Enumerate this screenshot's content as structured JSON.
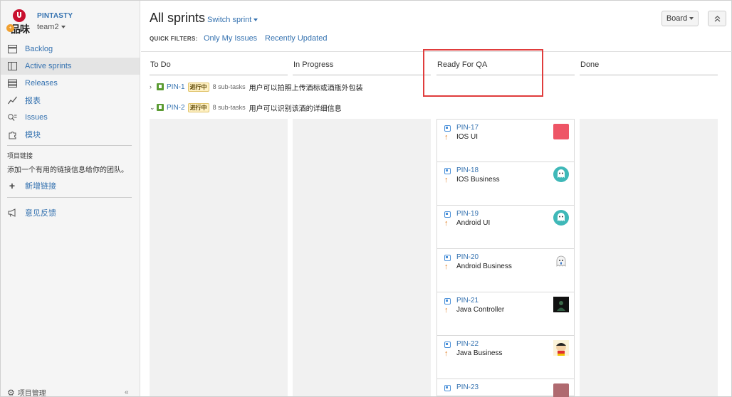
{
  "sidebar": {
    "logo_text": "品味",
    "logo_badge": "+",
    "project_name": "PINTASTY",
    "team": "team2",
    "nav": [
      {
        "label": "Backlog",
        "icon": "backlog-icon"
      },
      {
        "label": "Active sprints",
        "icon": "board-icon",
        "active": true
      },
      {
        "label": "Releases",
        "icon": "releases-icon"
      },
      {
        "label": "报表",
        "icon": "reports-icon"
      },
      {
        "label": "Issues",
        "icon": "issues-icon"
      },
      {
        "label": "模块",
        "icon": "components-icon"
      }
    ],
    "links_heading": "项目链接",
    "links_text": "添加一个有用的链接信息给你的团队。",
    "add_link": "新增链接",
    "feedback": "意见反馈",
    "project_settings": "项目管理",
    "collapse": "«"
  },
  "header": {
    "title": "All sprints",
    "switch_sprint": "Switch sprint",
    "quick_filters_label": "QUICK FILTERS:",
    "quick_filters": [
      "Only My Issues",
      "Recently Updated"
    ],
    "board_button": "Board",
    "collapse_button": "«"
  },
  "columns": [
    "To Do",
    "In Progress",
    "Ready For QA",
    "Done"
  ],
  "swimlanes": [
    {
      "chevron": "›",
      "key": "PIN-1",
      "status": "进行中",
      "subtasks": "8 sub-tasks",
      "summary": "用户可以拍照上传酒标或酒瓶外包装",
      "expanded": false
    },
    {
      "chevron": "⌄",
      "key": "PIN-2",
      "status": "进行中",
      "subtasks": "8 sub-tasks",
      "summary": "用户可以识别该酒的详细信息",
      "expanded": true
    }
  ],
  "cards": [
    {
      "key": "PIN-17",
      "summary": "IOS UI",
      "avatar": "red-square"
    },
    {
      "key": "PIN-18",
      "summary": "IOS Business",
      "avatar": "teal-ghost"
    },
    {
      "key": "PIN-19",
      "summary": "Android UI",
      "avatar": "teal-ghost"
    },
    {
      "key": "PIN-20",
      "summary": "Android Business",
      "avatar": "white-ghost"
    },
    {
      "key": "PIN-21",
      "summary": "Java Controller",
      "avatar": "dark-photo"
    },
    {
      "key": "PIN-22",
      "summary": "Java Business",
      "avatar": "cartoon"
    },
    {
      "key": "PIN-23",
      "summary": "",
      "avatar": "rose-square"
    }
  ],
  "colors": {
    "link": "#3572b0",
    "status_bg": "#fff1c4",
    "highlight": "#e03c3c",
    "priority_up": "#e07b1f"
  }
}
